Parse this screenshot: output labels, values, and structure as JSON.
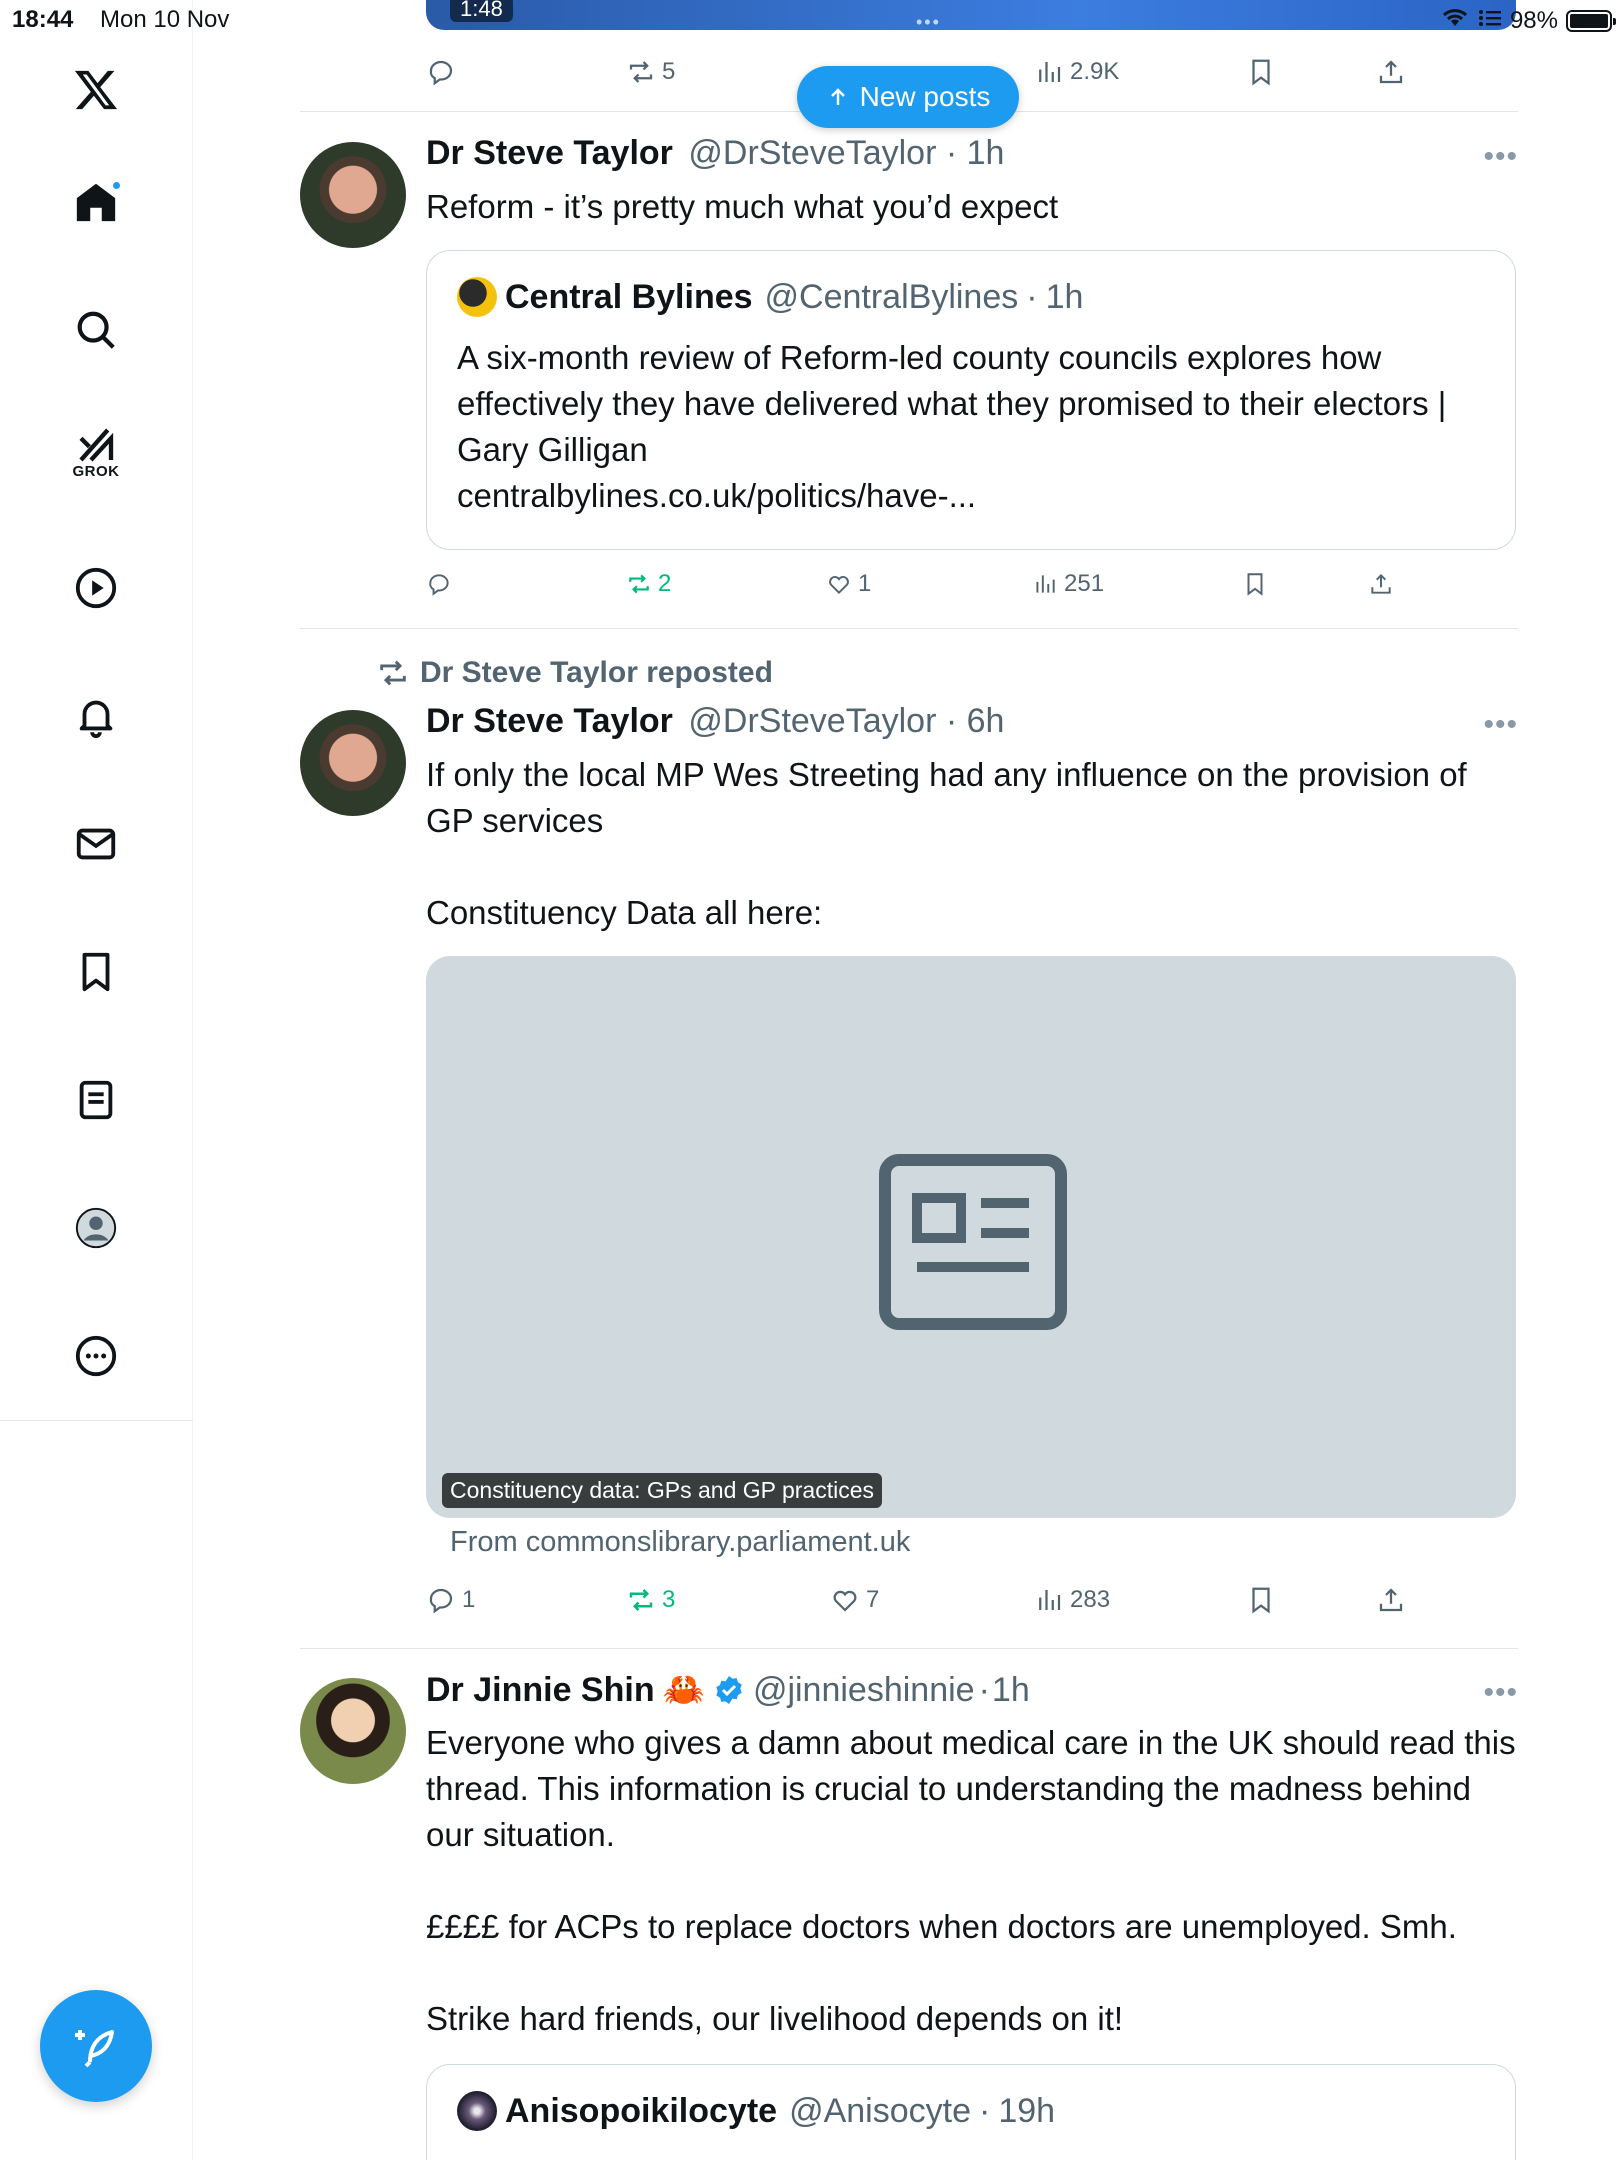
{
  "status_bar": {
    "time": "18:44",
    "date": "Mon 10 Nov",
    "battery": "98%"
  },
  "sidebar": {
    "items": [
      {
        "name": "home",
        "icon": "home-icon"
      },
      {
        "name": "search",
        "icon": "search-icon"
      },
      {
        "name": "grok",
        "icon": "grok-icon",
        "label": "GROK"
      },
      {
        "name": "video",
        "icon": "play-icon"
      },
      {
        "name": "notifications",
        "icon": "bell-icon"
      },
      {
        "name": "messages",
        "icon": "mail-icon"
      },
      {
        "name": "bookmarks",
        "icon": "bookmark-icon"
      },
      {
        "name": "lists",
        "icon": "list-icon"
      },
      {
        "name": "profile",
        "icon": "profile-icon"
      },
      {
        "name": "more",
        "icon": "more-icon"
      }
    ],
    "compose_icon": "compose-icon"
  },
  "new_posts": {
    "label": "New posts"
  },
  "top_post": {
    "media_time": "1:48",
    "retweets": "5",
    "views": "2.9K"
  },
  "posts": [
    {
      "name": "Dr Steve Taylor",
      "handle": "@DrSteveTaylor",
      "time": "1h",
      "text": "Reform - it’s pretty much what you’d expect",
      "quote": {
        "name": "Central Bylines",
        "handle": "@CentralBylines",
        "time": "1h",
        "text": "A six-month review of Reform-led county councils explores how effectively they have delivered what they promised to their electors | Gary Gilligan\ncentralbylines.co.uk/politics/have-..."
      },
      "stats": {
        "replies": "",
        "retweets": "2",
        "likes": "1",
        "views": "251"
      }
    },
    {
      "repost_label": "Dr Steve Taylor reposted",
      "name": "Dr Steve Taylor",
      "handle": "@DrSteveTaylor",
      "time": "6h",
      "text": "If only the local MP Wes Streeting had any influence on the provision of GP services\n\nConstituency Data all here:",
      "card_caption": "Constituency data: GPs and GP practices",
      "card_from": "From commonslibrary.parliament.uk",
      "stats": {
        "replies": "1",
        "retweets": "3",
        "likes": "7",
        "views": "283"
      }
    },
    {
      "name": "Dr Jinnie Shin",
      "emoji": "🦀",
      "handle": "@jinnieshinnie",
      "time": "1h",
      "text": "Everyone who gives a damn about medical care in the UK should read this thread. This information is crucial to understanding the madness behind our situation.\n\n££££ for ACPs to replace doctors when doctors are unemployed. Smh.\n\nStrike hard friends, our livelihood depends on it!",
      "quote": {
        "name": "Anisopoikilocyte",
        "handle": "@Anisocyte",
        "time": "19h"
      }
    }
  ],
  "colors": {
    "accent": "#1d9bf0",
    "retweet_green": "#00ba7c",
    "muted": "#536471"
  }
}
